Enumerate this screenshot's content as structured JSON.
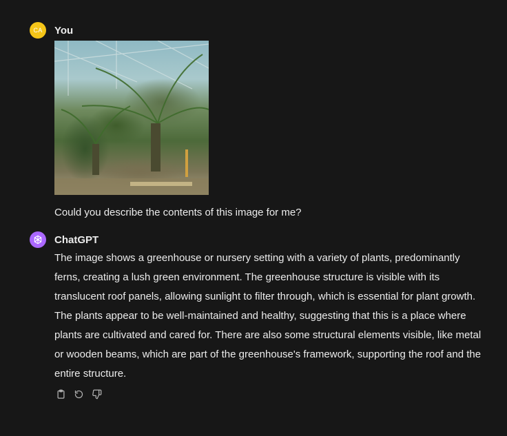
{
  "user_message": {
    "avatar_initials": "CA",
    "author": "You",
    "text": "Could you describe the contents of this image for me?"
  },
  "assistant_message": {
    "author": "ChatGPT",
    "text": "The image shows a greenhouse or nursery setting with a variety of plants, predominantly ferns, creating a lush green environment. The greenhouse structure is visible with its translucent roof panels, allowing sunlight to filter through, which is essential for plant growth. The plants appear to be well-maintained and healthy, suggesting that this is a place where plants are cultivated and cared for. There are also some structural elements visible, like metal or wooden beams, which are part of the greenhouse's framework, supporting the roof and the entire structure.",
    "actions": [
      "copy-icon",
      "regenerate-icon",
      "thumbs-down-icon"
    ]
  },
  "colors": {
    "background": "#171717",
    "text": "#ececec",
    "user_avatar": "#f5c518",
    "bot_avatar": "#ab68ff",
    "icon": "#b4b4b4"
  }
}
